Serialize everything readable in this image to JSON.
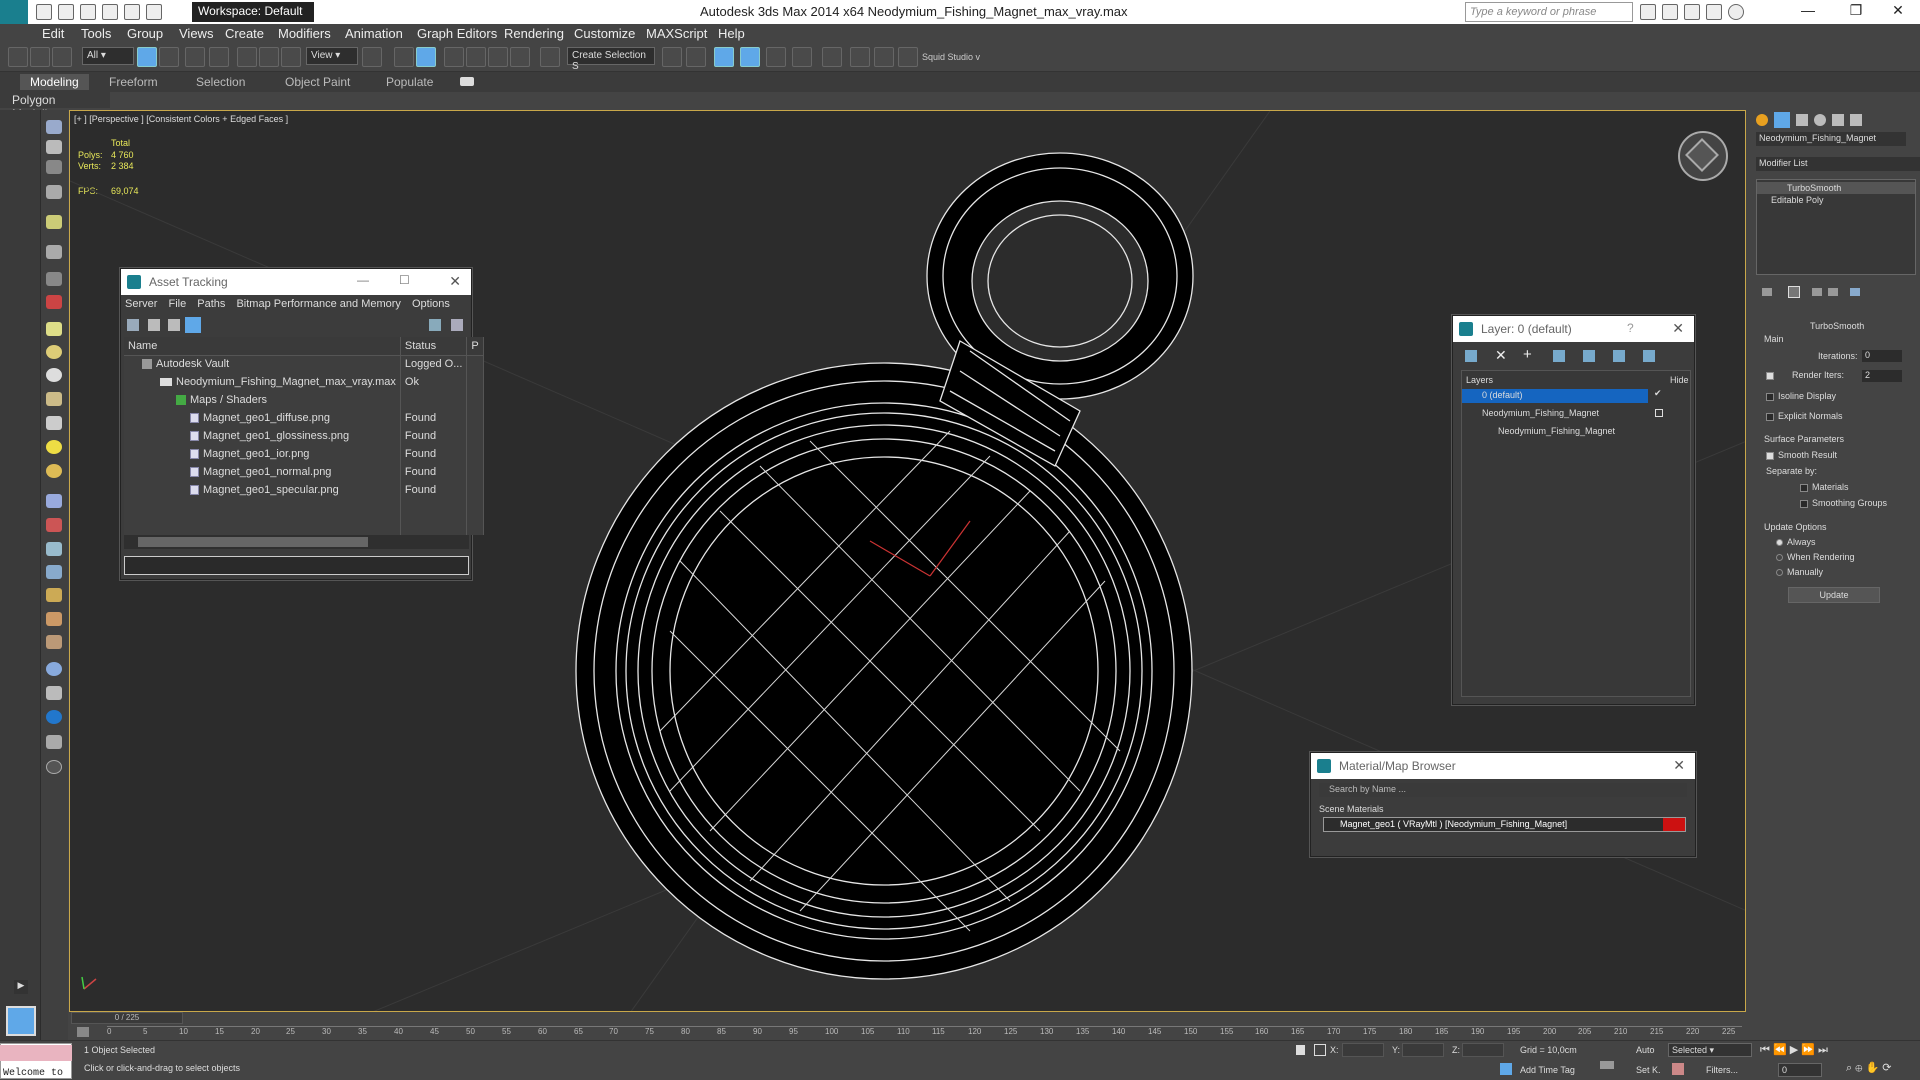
{
  "app": {
    "title": "Autodesk 3ds Max  2014 x64     Neodymium_Fishing_Magnet_max_vray.max",
    "workspace": "Workspace: Default",
    "search_placeholder": "Type a keyword or phrase"
  },
  "menu": [
    "Edit",
    "Tools",
    "Group",
    "Views",
    "Create",
    "Modifiers",
    "Animation",
    "Graph Editors",
    "Rendering",
    "Customize",
    "MAXScript",
    "Help"
  ],
  "toolbar": {
    "selection_filter": "All",
    "ref_coord": "View",
    "named_selection": "Create Selection S",
    "squid": "Squid Studio v"
  },
  "ribbon": {
    "tabs": [
      "Modeling",
      "Freeform",
      "Selection",
      "Object Paint",
      "Populate"
    ],
    "active_tab": "Modeling",
    "panel": "Polygon Modeling"
  },
  "viewport": {
    "label": "[+ ] [Perspective ] [Consistent Colors + Edged Faces ]",
    "stats": {
      "total_label": "Total",
      "polys_label": "Polys:",
      "polys": "4 760",
      "verts_label": "Verts:",
      "verts": "2 384",
      "fps_label": "FPS:",
      "fps": "69,074"
    }
  },
  "asset_tracking": {
    "title": "Asset Tracking",
    "menu": [
      "Server",
      "File",
      "Paths",
      "Bitmap Performance and Memory",
      "Options"
    ],
    "columns": [
      "Name",
      "Status",
      "P"
    ],
    "rows": [
      {
        "name": "Autodesk Vault",
        "status": "Logged O..."
      },
      {
        "name": "Neodymium_Fishing_Magnet_max_vray.max",
        "status": "Ok"
      },
      {
        "name": "Maps / Shaders",
        "status": ""
      },
      {
        "name": "Magnet_geo1_diffuse.png",
        "status": "Found"
      },
      {
        "name": "Magnet_geo1_glossiness.png",
        "status": "Found"
      },
      {
        "name": "Magnet_geo1_ior.png",
        "status": "Found"
      },
      {
        "name": "Magnet_geo1_normal.png",
        "status": "Found"
      },
      {
        "name": "Magnet_geo1_specular.png",
        "status": "Found"
      }
    ]
  },
  "layers": {
    "title": "Layer: 0 (default)",
    "header": "Layers",
    "hide": "Hide",
    "items": [
      "0 (default)",
      "Neodymium_Fishing_Magnet",
      "Neodymium_Fishing_Magnet"
    ]
  },
  "material_browser": {
    "title": "Material/Map Browser",
    "search": "Search by Name ...",
    "section": "Scene Materials",
    "item": "Magnet_geo1  ( VRayMtl ) [Neodymium_Fishing_Magnet]"
  },
  "command_panel": {
    "object_name": "Neodymium_Fishing_Magnet",
    "modifier_list": "Modifier List",
    "stack": [
      "TurboSmooth",
      "Editable Poly"
    ],
    "rollout": "TurboSmooth",
    "main": "Main",
    "iterations_label": "Iterations:",
    "iterations": "0",
    "render_iters_label": "Render Iters:",
    "render_iters": "2",
    "isoline": "Isoline Display",
    "explicit": "Explicit Normals",
    "surface": "Surface Parameters",
    "smooth_result": "Smooth Result",
    "separate_by": "Separate by:",
    "materials": "Materials",
    "smoothing_groups": "Smoothing Groups",
    "update_options": "Update Options",
    "always": "Always",
    "when_rendering": "When Rendering",
    "manually": "Manually",
    "update_btn": "Update"
  },
  "timeline": {
    "frame": "0 / 225",
    "ticks": [
      "0",
      "5",
      "10",
      "15",
      "20",
      "25",
      "30",
      "35",
      "40",
      "45",
      "50",
      "55",
      "60",
      "65",
      "70",
      "75",
      "80",
      "85",
      "90",
      "95",
      "100",
      "105",
      "110",
      "115",
      "120",
      "125",
      "130",
      "135",
      "140",
      "145",
      "150",
      "155",
      "160",
      "165",
      "170",
      "175",
      "180",
      "185",
      "190",
      "195",
      "200",
      "205",
      "210",
      "215",
      "220",
      "225"
    ]
  },
  "status": {
    "welcome": "Welcome to",
    "selected": "1 Object Selected",
    "hint": "Click or click-and-drag to select objects",
    "x_label": "X:",
    "y_label": "Y:",
    "z_label": "Z:",
    "grid": "Grid = 10,0cm",
    "add_time_tag": "Add Time Tag",
    "auto": "Auto",
    "set_k": "Set K.",
    "selected_dd": "Selected",
    "filters": "Filters...",
    "frame_field": "0"
  },
  "colors": {
    "accent": "#5fa8e8",
    "selection": "#1565c0",
    "viewport_border": "#c9a84a",
    "material_swatch": "#cc1111"
  }
}
